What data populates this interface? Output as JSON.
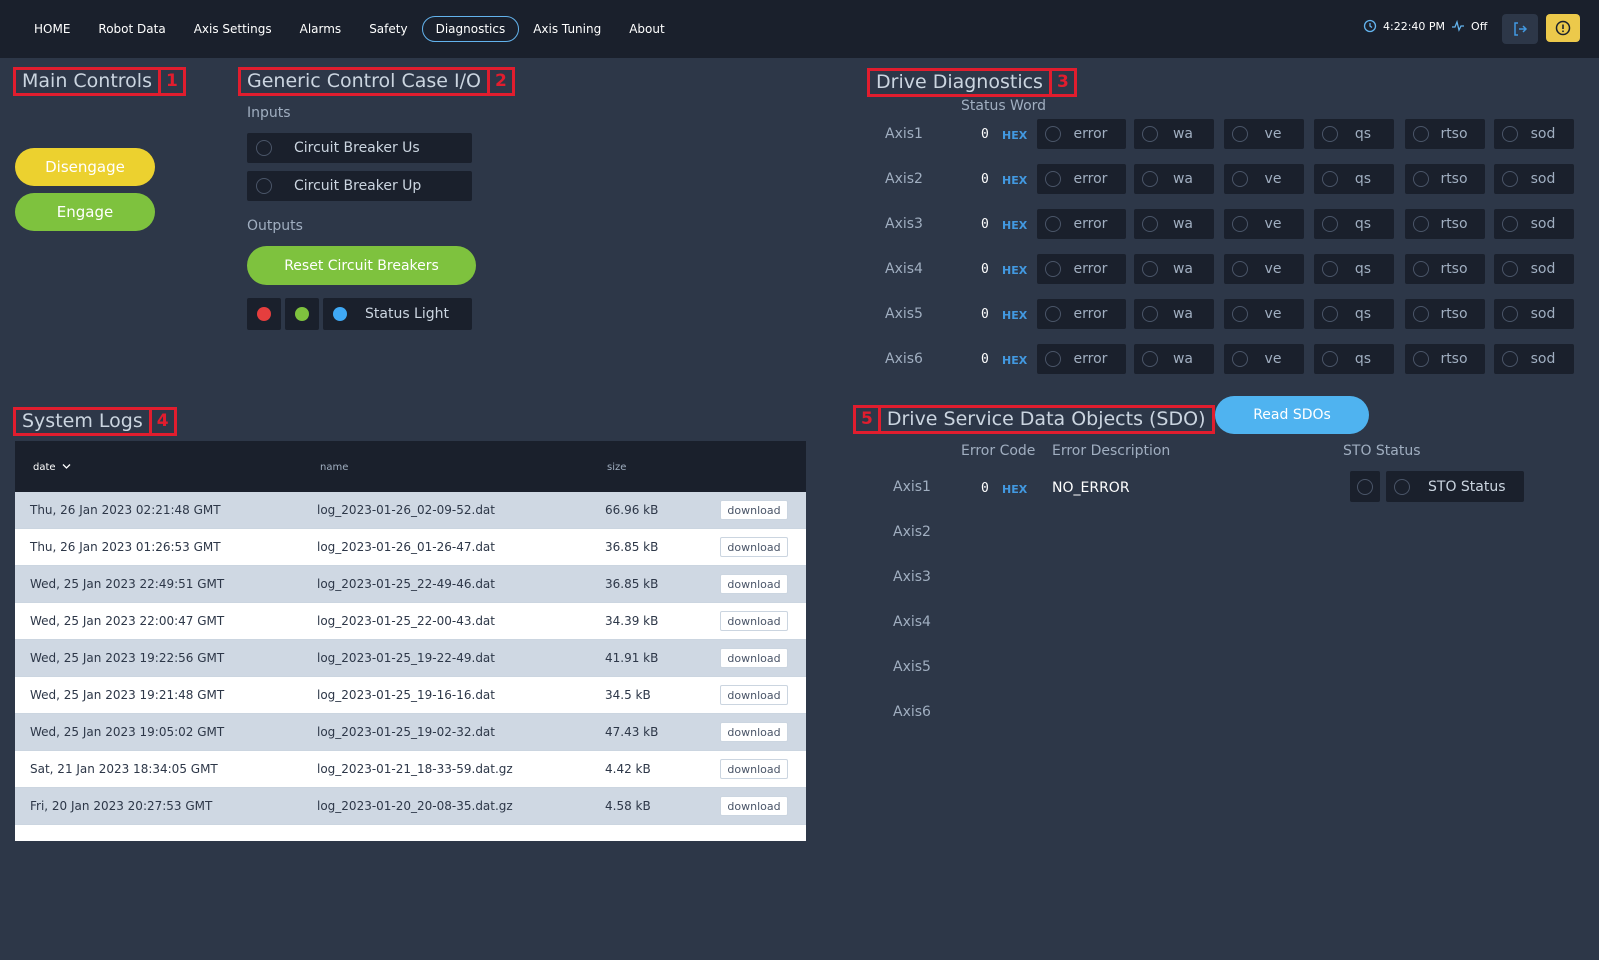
{
  "nav": {
    "items": [
      "HOME",
      "Robot Data",
      "Axis Settings",
      "Alarms",
      "Safety",
      "Diagnostics",
      "Axis Tuning",
      "About"
    ],
    "active": "Diagnostics"
  },
  "status": {
    "time": "4:22:40 PM",
    "heartbeat": "Off"
  },
  "sections": {
    "main_controls": {
      "title": "Main Controls",
      "num": "1"
    },
    "generic_io": {
      "title": "Generic Control Case I/O",
      "num": "2"
    },
    "drive_diag": {
      "title": "Drive Diagnostics",
      "num": "3"
    },
    "system_logs": {
      "title": "System Logs",
      "num": "4"
    },
    "sdo": {
      "title": "Drive Service Data Objects (SDO)",
      "num": "5"
    }
  },
  "main_controls": {
    "disengage": "Disengage",
    "engage": "Engage"
  },
  "generic_io": {
    "inputs_label": "Inputs",
    "inputs": [
      "Circuit Breaker Us",
      "Circuit Breaker Up"
    ],
    "outputs_label": "Outputs",
    "reset_button": "Reset Circuit Breakers",
    "status_light": "Status Light",
    "light_colors": {
      "red": "#e53e3e",
      "green": "#7ec23e",
      "blue": "#3fa9f5"
    }
  },
  "drive_diag": {
    "status_word_header": "Status Word",
    "hex_label": "HEX",
    "flags": [
      "error",
      "wa",
      "ve",
      "qs",
      "rtso",
      "sod"
    ],
    "axes": [
      {
        "name": "Axis1",
        "value": "0"
      },
      {
        "name": "Axis2",
        "value": "0"
      },
      {
        "name": "Axis3",
        "value": "0"
      },
      {
        "name": "Axis4",
        "value": "0"
      },
      {
        "name": "Axis5",
        "value": "0"
      },
      {
        "name": "Axis6",
        "value": "0"
      }
    ]
  },
  "sdo": {
    "read_button": "Read SDOs",
    "headers": {
      "error_code": "Error Code",
      "error_description": "Error Description",
      "sto_status": "STO Status"
    },
    "axes": [
      "Axis1",
      "Axis2",
      "Axis3",
      "Axis4",
      "Axis5",
      "Axis6"
    ],
    "axis1": {
      "code": "0",
      "hex": "HEX",
      "description": "NO_ERROR",
      "sto_label": "STO Status"
    }
  },
  "logs": {
    "columns": {
      "date": "date",
      "name": "name",
      "size": "size"
    },
    "download_label": "download",
    "rows": [
      {
        "date": "Thu, 26 Jan 2023 02:21:48 GMT",
        "name": "log_2023-01-26_02-09-52.dat",
        "size": "66.96 kB"
      },
      {
        "date": "Thu, 26 Jan 2023 01:26:53 GMT",
        "name": "log_2023-01-26_01-26-47.dat",
        "size": "36.85 kB"
      },
      {
        "date": "Wed, 25 Jan 2023 22:49:51 GMT",
        "name": "log_2023-01-25_22-49-46.dat",
        "size": "36.85 kB"
      },
      {
        "date": "Wed, 25 Jan 2023 22:00:47 GMT",
        "name": "log_2023-01-25_22-00-43.dat",
        "size": "34.39 kB"
      },
      {
        "date": "Wed, 25 Jan 2023 19:22:56 GMT",
        "name": "log_2023-01-25_19-22-49.dat",
        "size": "41.91 kB"
      },
      {
        "date": "Wed, 25 Jan 2023 19:21:48 GMT",
        "name": "log_2023-01-25_19-16-16.dat",
        "size": "34.5 kB"
      },
      {
        "date": "Wed, 25 Jan 2023 19:05:02 GMT",
        "name": "log_2023-01-25_19-02-32.dat",
        "size": "47.43 kB"
      },
      {
        "date": "Sat, 21 Jan 2023 18:34:05 GMT",
        "name": "log_2023-01-21_18-33-59.dat.gz",
        "size": "4.42 kB"
      },
      {
        "date": "Fri, 20 Jan 2023 20:27:53 GMT",
        "name": "log_2023-01-20_20-08-35.dat.gz",
        "size": "4.58 kB"
      }
    ]
  }
}
